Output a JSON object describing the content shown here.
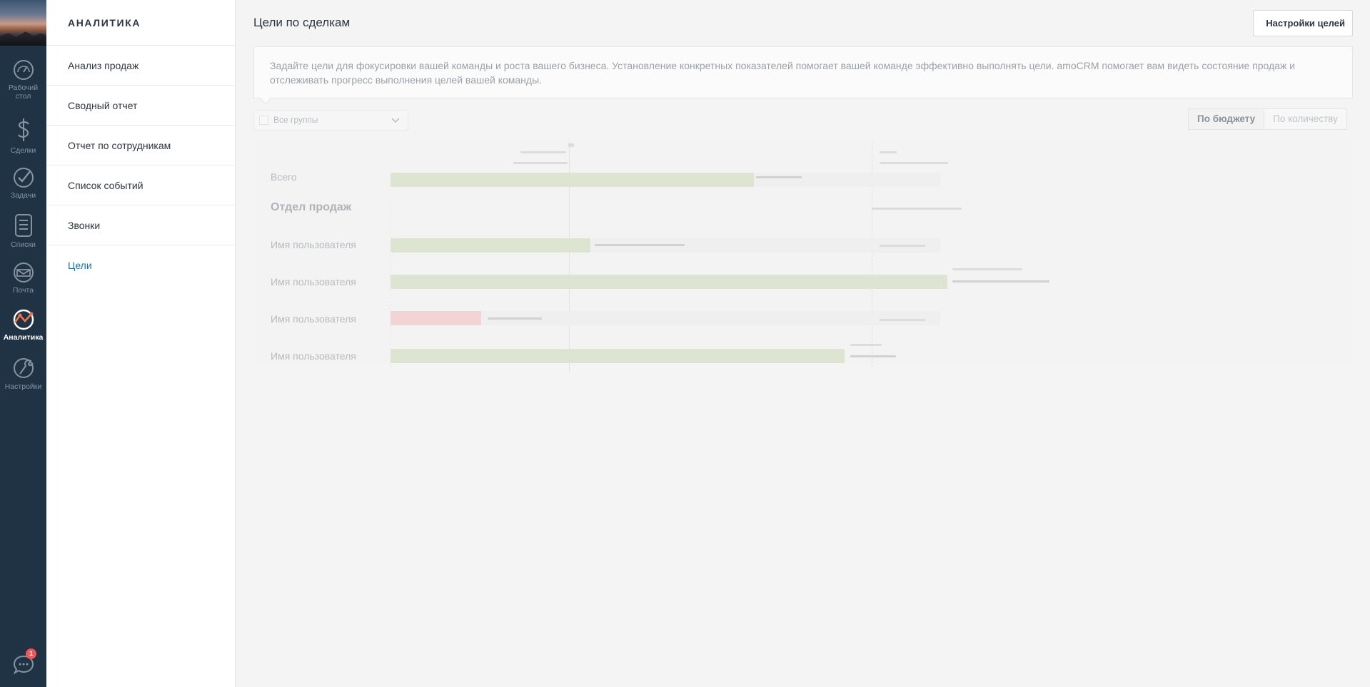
{
  "nav": {
    "items": [
      {
        "label": "Рабочий стол",
        "icon": "dashboard-gauge-icon"
      },
      {
        "label": "Сделки",
        "icon": "dollar-icon"
      },
      {
        "label": "Задачи",
        "icon": "checkmark-icon"
      },
      {
        "label": "Списки",
        "icon": "list-icon"
      },
      {
        "label": "Почта",
        "icon": "mail-icon"
      },
      {
        "label": "Аналитика",
        "icon": "analytics-chart-icon",
        "active": true
      },
      {
        "label": "Настройки",
        "icon": "wrench-icon"
      }
    ],
    "chat_badge": "1"
  },
  "submenu": {
    "title": "АНАЛИТИКА",
    "items": [
      {
        "label": "Анализ продаж"
      },
      {
        "label": "Сводный отчет"
      },
      {
        "label": "Отчет по сотрудникам"
      },
      {
        "label": "Список событий"
      },
      {
        "label": "Звонки"
      },
      {
        "label": "Цели",
        "active": true
      }
    ]
  },
  "main": {
    "title": "Цели по сделкам",
    "settings_button": "Настройки целей",
    "info_text": "Задайте цели для фокусировки вашей команды и роста вашего бизнеса. Установление конкретных показателей помогает вашей команде эффективно выполнять цели. amoCRM помогает вам видеть состояние продаж и отслеживать прогресс выполнения целей вашей команды.",
    "group_select": "Все группы",
    "toggle": {
      "budget": "По бюджету",
      "quantity": "По количеству",
      "selected": "budget"
    }
  },
  "chart_data": {
    "type": "bar",
    "rows": [
      {
        "label": "Всего",
        "progress": 0.6,
        "status": "ok"
      },
      {
        "label": "Отдел продаж",
        "is_group": true
      },
      {
        "label": "Имя пользователя",
        "progress": 0.33,
        "status": "ok"
      },
      {
        "label": "Имя пользователя",
        "progress": 0.92,
        "status": "ok"
      },
      {
        "label": "Имя пользователя",
        "progress": 0.15,
        "status": "behind"
      },
      {
        "label": "Имя пользователя",
        "progress": 0.75,
        "status": "ok"
      }
    ]
  },
  "colors": {
    "nav_bg": "#1f3344",
    "accent": "#1375ab",
    "bar_ok": "#dde5d2",
    "bar_behind": "#f2d4d4",
    "badge": "#f25757"
  }
}
